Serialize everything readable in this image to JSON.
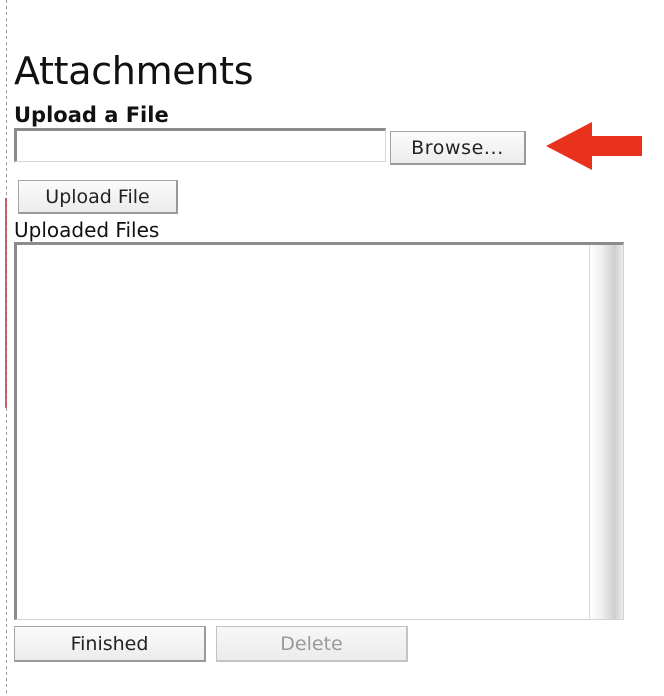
{
  "page": {
    "title": "Attachments"
  },
  "upload": {
    "section_label": "Upload a File",
    "file_input_value": "",
    "browse_label": "Browse...",
    "upload_button_label": "Upload File"
  },
  "files": {
    "label": "Uploaded Files",
    "items": []
  },
  "actions": {
    "finished_label": "Finished",
    "delete_label": "Delete",
    "delete_enabled": false
  },
  "annotation": {
    "arrow_color": "#e8321c",
    "icon": "arrow-left-icon"
  }
}
